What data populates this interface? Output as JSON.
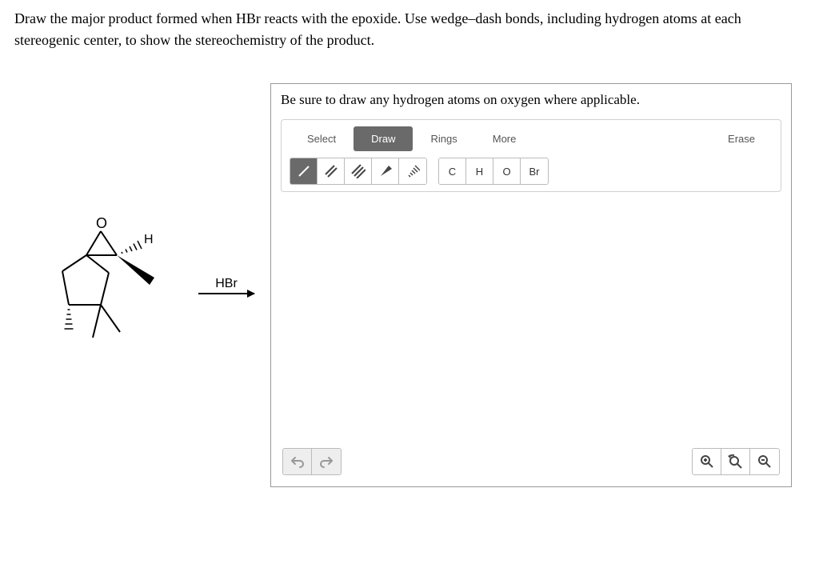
{
  "question": {
    "line1": "Draw the major product formed when HBr reacts with the epoxide. Use wedge–dash bonds, including hydrogen atoms at each",
    "line2": "stereogenic center, to show the stereochemistry of the product."
  },
  "reaction": {
    "reagent": "HBr"
  },
  "editor": {
    "instruction": "Be sure to draw any hydrogen atoms on oxygen where applicable.",
    "tabs": {
      "select": "Select",
      "draw": "Draw",
      "rings": "Rings",
      "more": "More"
    },
    "erase": "Erase",
    "atoms": {
      "c": "C",
      "h": "H",
      "o": "O",
      "br": "Br"
    }
  },
  "molecule_labels": {
    "o": "O",
    "h": "H"
  }
}
